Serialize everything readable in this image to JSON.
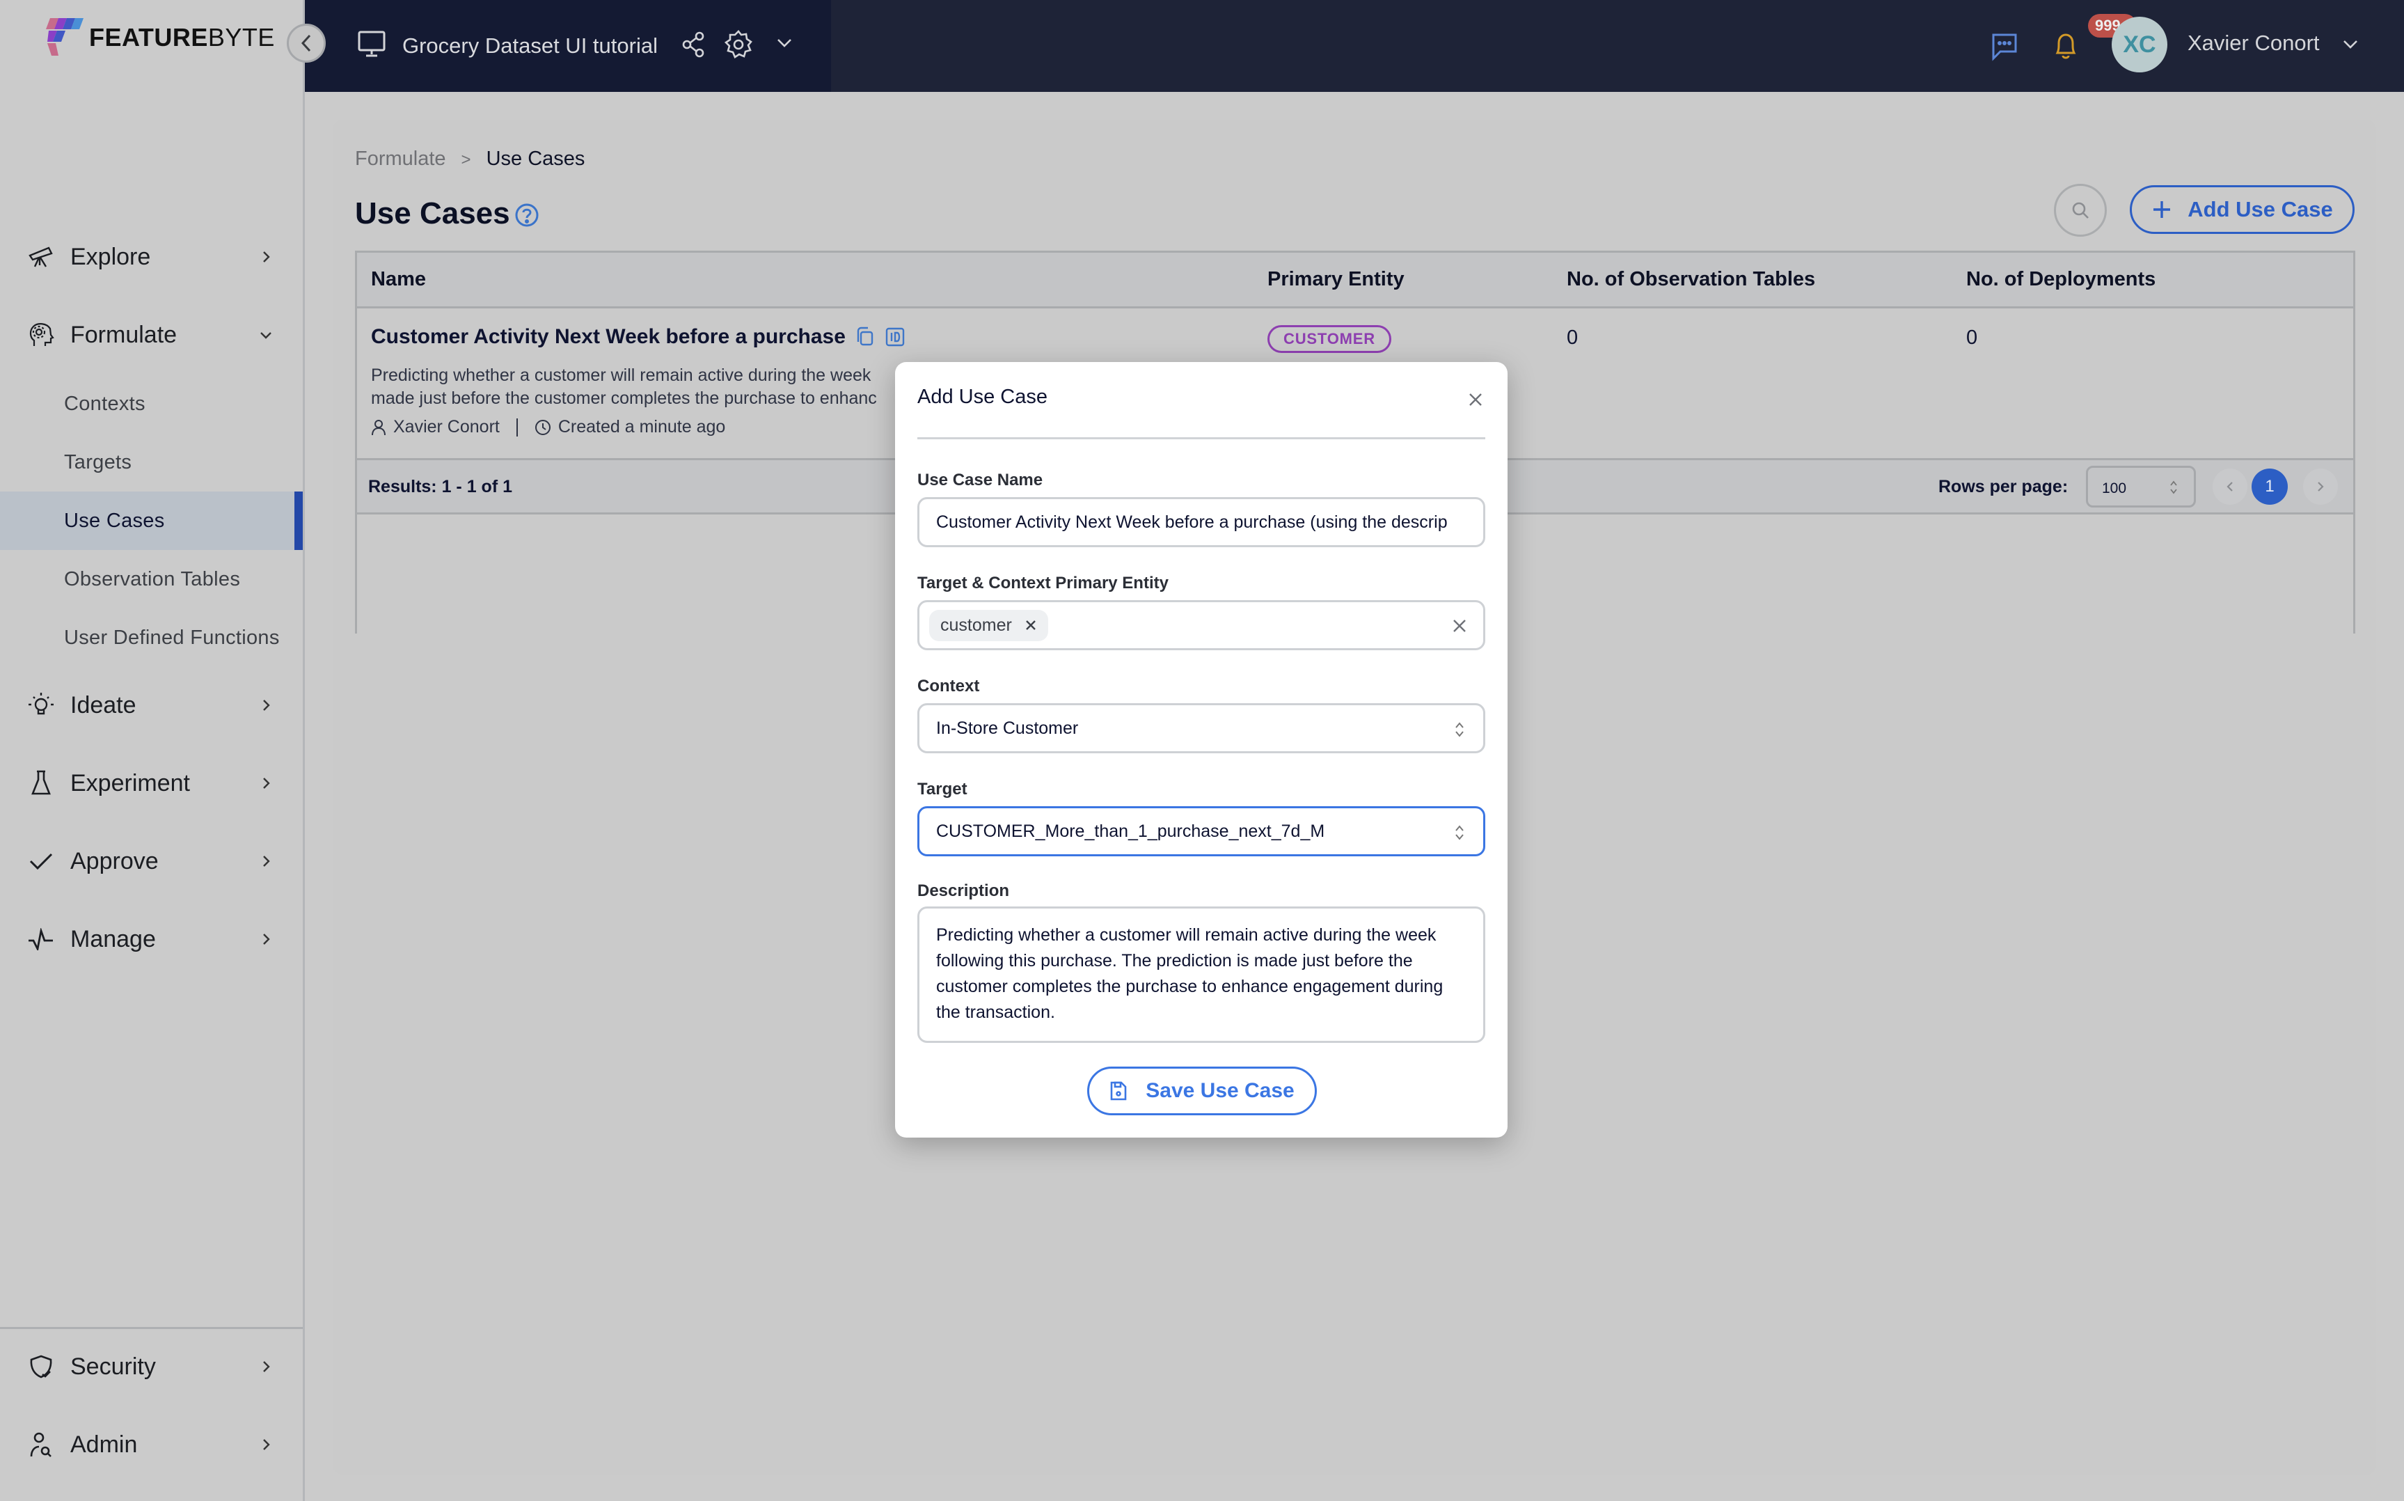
{
  "app": {
    "logo_text_bold": "FEATURE",
    "logo_text_light": "BYTE",
    "project_name": "Grocery Dataset UI tutorial",
    "notification_count": "999+",
    "user_initials": "XC",
    "user_name": "Xavier Conort"
  },
  "sidebar": {
    "items": [
      {
        "label": "Explore",
        "icon": "telescope-icon",
        "expanded": false
      },
      {
        "label": "Formulate",
        "icon": "head-gear-icon",
        "expanded": true
      },
      {
        "label": "Ideate",
        "icon": "lightbulb-icon",
        "expanded": false
      },
      {
        "label": "Experiment",
        "icon": "flask-icon",
        "expanded": false
      },
      {
        "label": "Approve",
        "icon": "check-icon",
        "expanded": false
      },
      {
        "label": "Manage",
        "icon": "pulse-icon",
        "expanded": false
      }
    ],
    "sub_items": [
      {
        "label": "Contexts",
        "active": false
      },
      {
        "label": "Targets",
        "active": false
      },
      {
        "label": "Use Cases",
        "active": true
      },
      {
        "label": "Observation Tables",
        "active": false
      },
      {
        "label": "User Defined Functions",
        "active": false
      }
    ],
    "bottom_items": [
      {
        "label": "Security",
        "icon": "shield-check-icon"
      },
      {
        "label": "Admin",
        "icon": "user-search-icon"
      }
    ]
  },
  "breadcrumb": {
    "parent": "Formulate",
    "separator": ">",
    "current": "Use Cases"
  },
  "page": {
    "title": "Use Cases",
    "add_button_label": "Add Use Case"
  },
  "table": {
    "columns": [
      "Name",
      "Primary Entity",
      "No. of Observation Tables",
      "No. of Deployments"
    ],
    "rows": [
      {
        "name": "Customer Activity Next Week before a purchase",
        "description": "Predicting whether a customer will remain active during the week following this purchase. The prediction is made just before the customer completes the purchase to enhance engagement during the transaction.",
        "description_visible_line1": "Predicting whether a customer will remain active during the week",
        "description_visible_line2": "made just before the customer completes the purchase to enhanc",
        "author": "Xavier Conort",
        "created": "Created a minute ago",
        "primary_entity": "CUSTOMER",
        "observation_tables": "0",
        "deployments": "0"
      }
    ],
    "results_text": "Results: 1 - 1 of 1",
    "rows_per_page_label": "Rows per page:",
    "rows_per_page": "100",
    "current_page": "1"
  },
  "modal": {
    "title": "Add Use Case",
    "fields": {
      "name_label": "Use Case Name",
      "name_value": "Customer Activity Next Week before a purchase (using the descrip",
      "entity_label": "Target & Context Primary Entity",
      "entity_chip": "customer",
      "context_label": "Context",
      "context_value": "In-Store Customer",
      "target_label": "Target",
      "target_value": "CUSTOMER_More_than_1_purchase_next_7d_M",
      "description_label": "Description",
      "description_value": "Predicting whether a customer will remain active during the week following this purchase. The prediction is made just before the customer completes the purchase to enhance engagement during the transaction."
    },
    "save_label": "Save Use Case"
  },
  "colors": {
    "accent": "#2c5ec4",
    "topbar": "#1e2337",
    "entity_badge": "#8d3fb0",
    "notification_badge": "#bd5049"
  }
}
